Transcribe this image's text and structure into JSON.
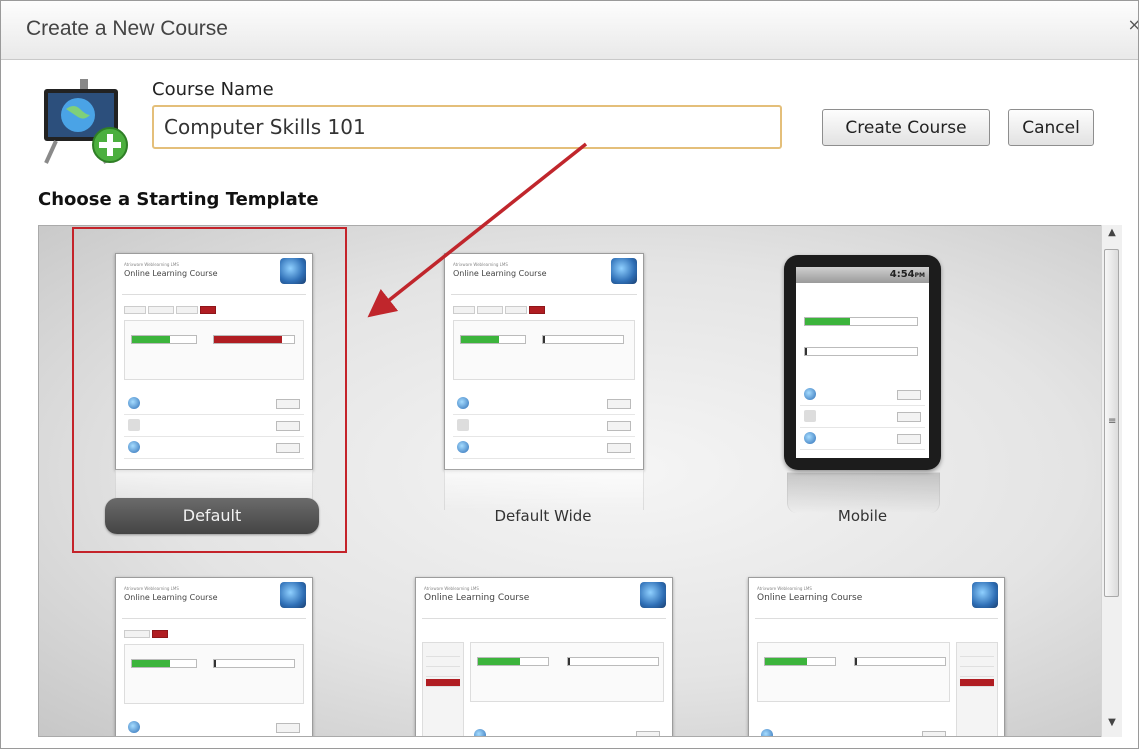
{
  "dialog": {
    "title": "Create a New Course",
    "close_glyph": "×"
  },
  "form": {
    "course_name_label": "Course Name",
    "course_name_value": "Computer Skills 101",
    "create_button": "Create Course",
    "cancel_button": "Cancel"
  },
  "templates": {
    "heading": "Choose a Starting Template",
    "selected": "Default",
    "items": [
      {
        "label": "Default"
      },
      {
        "label": "Default Wide"
      },
      {
        "label": "Mobile"
      }
    ],
    "preview": {
      "app_name": "Atrixware Weblearning LMS",
      "course_title": "Online Learning Course",
      "mobile_time": "4:54",
      "mobile_ampm": "PM"
    }
  },
  "icons": {
    "app": "course-add-icon",
    "scroll_up": "scroll-up-icon",
    "scroll_down": "scroll-down-icon",
    "annotation": "red-arrow-annotation"
  },
  "colors": {
    "input_border": "#e4bf7a",
    "selection_border": "#c4232a",
    "annotation_arrow": "#c0262c",
    "accent_red": "#b01d22",
    "progress_green": "#3cb43c"
  }
}
